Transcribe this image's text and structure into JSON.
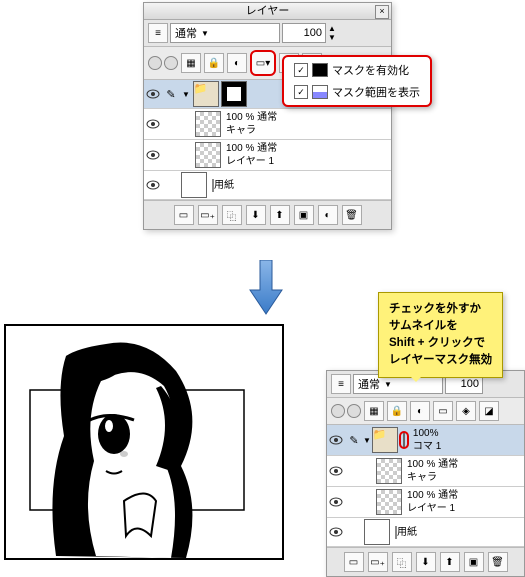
{
  "panelTitle": "レイヤー",
  "blendMode": "通常",
  "opacity": "100",
  "menu": {
    "enableMask": "マスクを有効化",
    "showMaskRange": "マスク範囲を表示"
  },
  "top": {
    "l1mode": "100 % 通常",
    "l1name": "キャラ",
    "l2mode": "100 % 通常",
    "l2name": "レイヤー 1",
    "paper": "用紙"
  },
  "bot": {
    "l0mode": "100%",
    "l0name": "コマ 1",
    "l1mode": "100 % 通常",
    "l1name": "キャラ",
    "l2mode": "100 % 通常",
    "l2name": "レイヤー 1",
    "paper": "用紙"
  },
  "tip": {
    "ln1": "チェックを外すか",
    "ln2": "サムネイルを",
    "ln3": "Shift + クリックで",
    "ln4": "レイヤーマスク無効"
  }
}
